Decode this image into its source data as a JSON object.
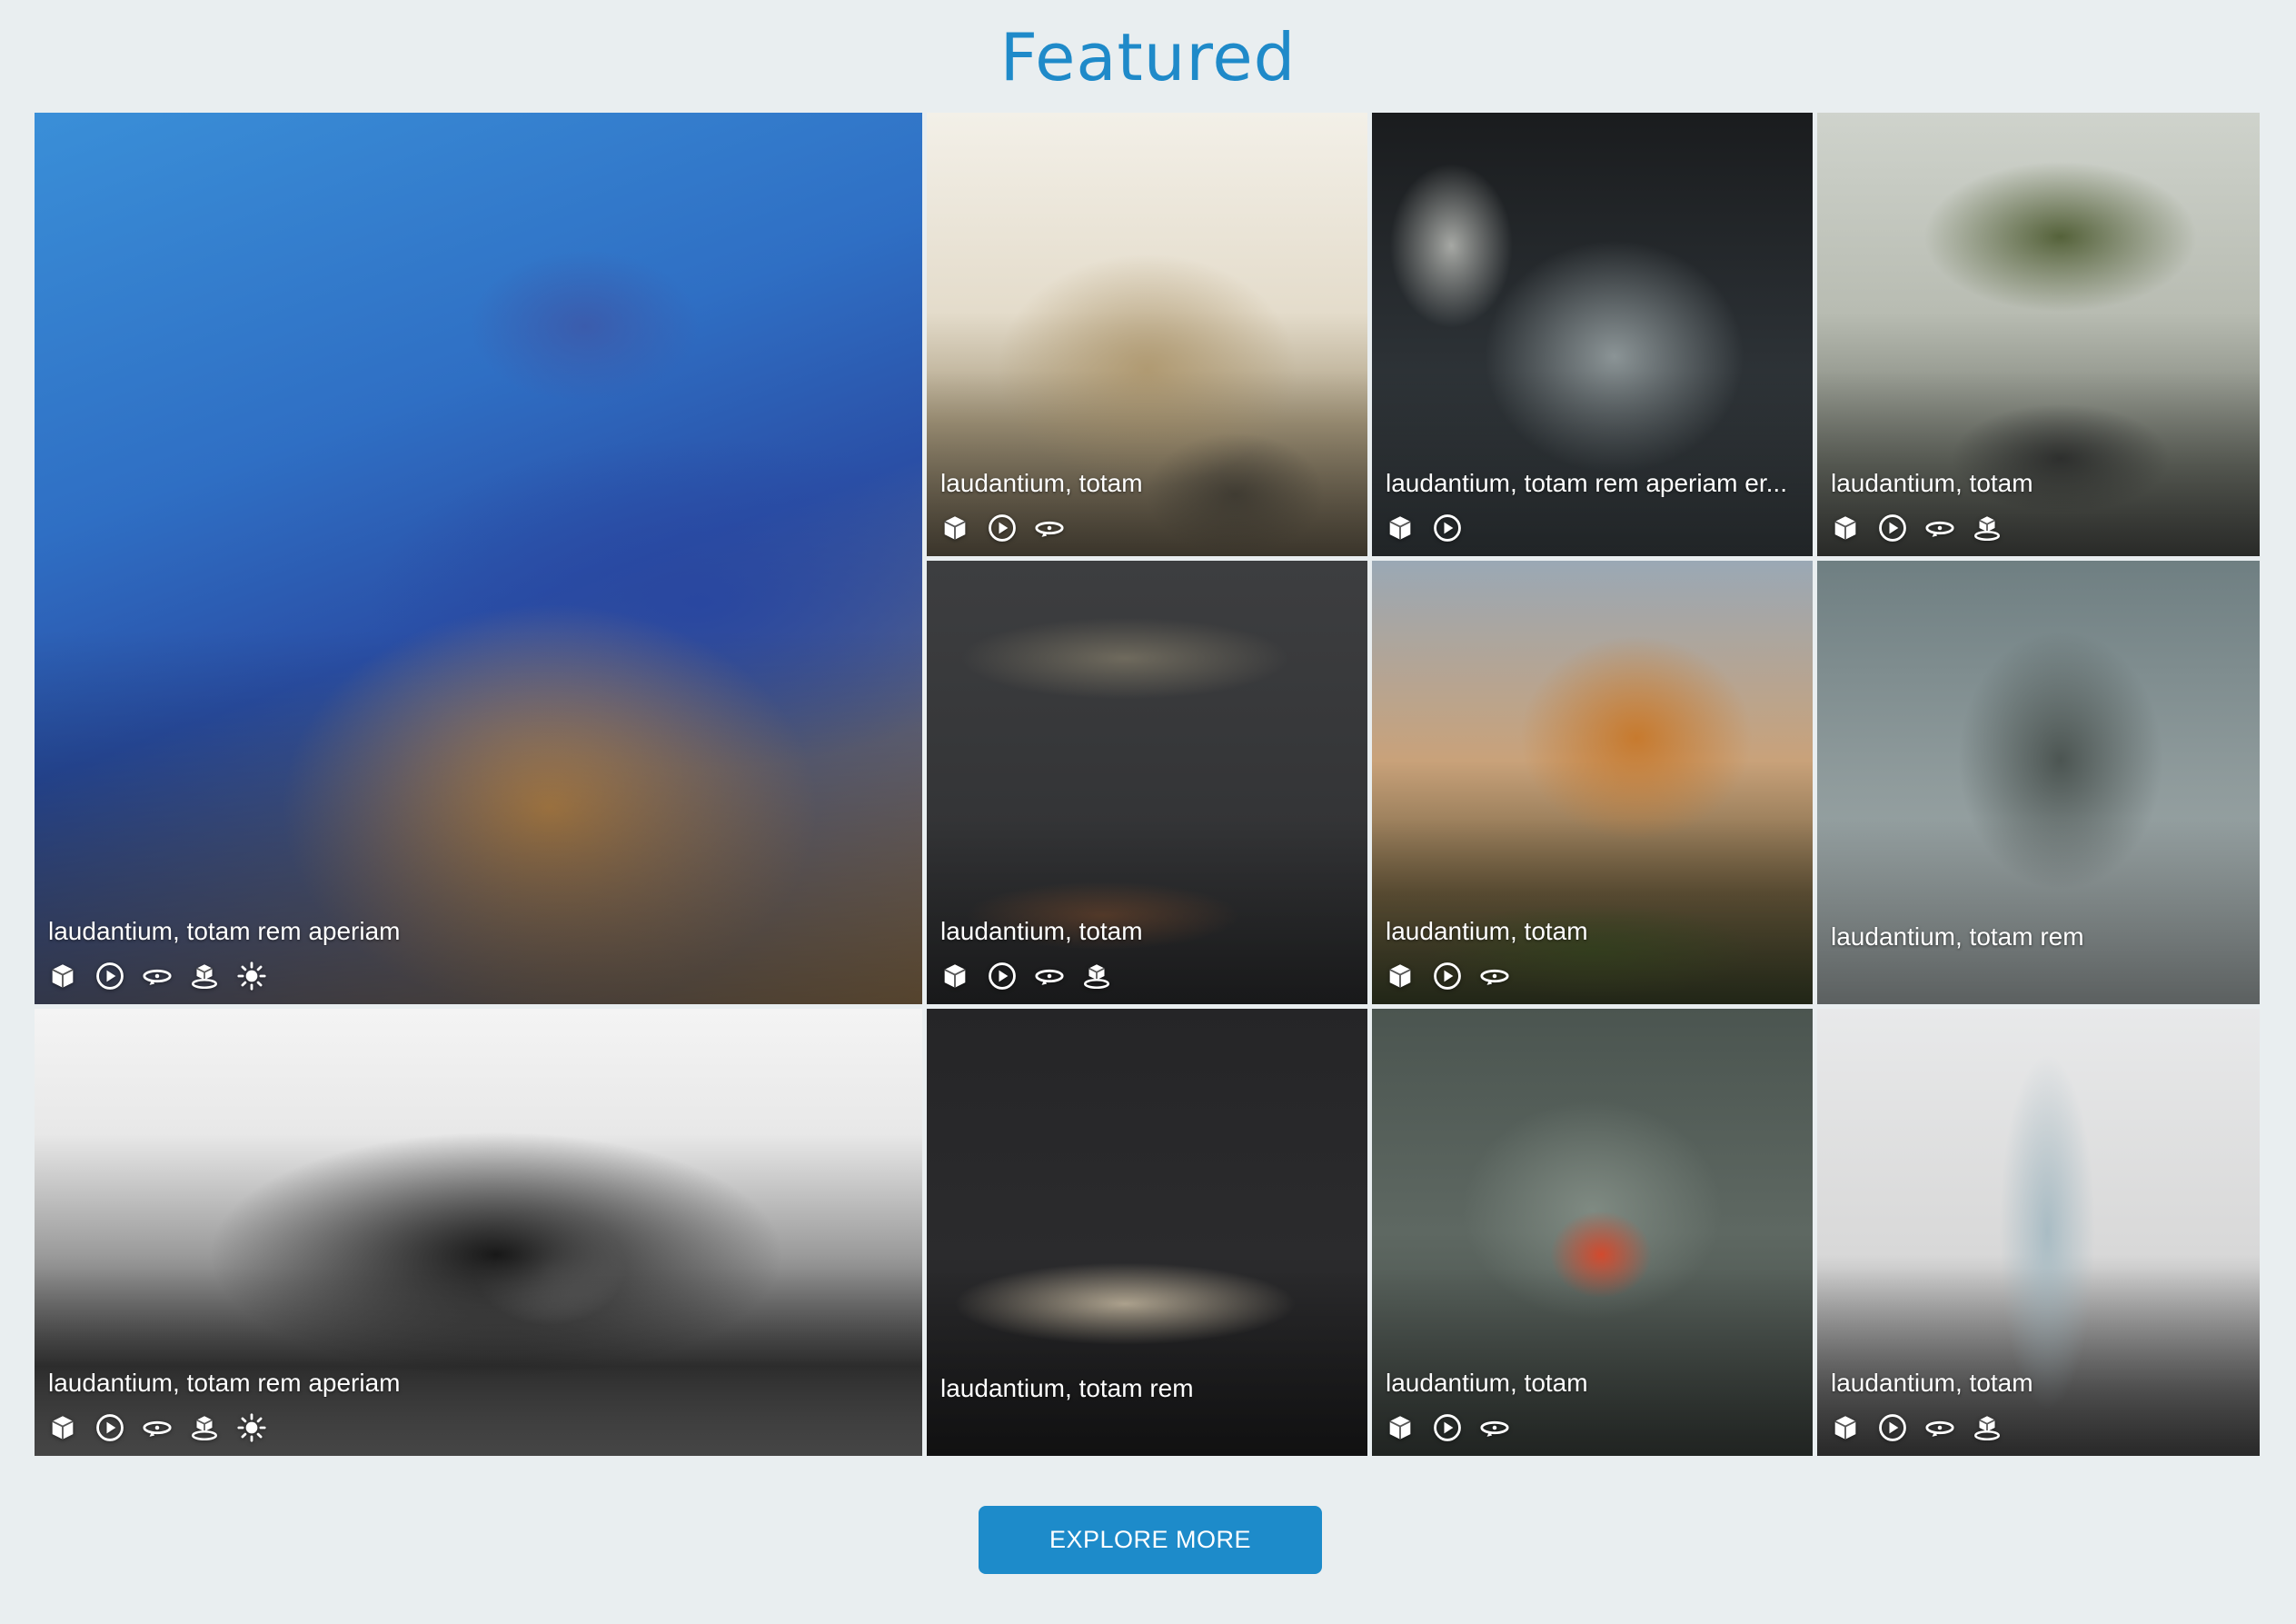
{
  "page": {
    "title": "Featured"
  },
  "icon_colors": {
    "icon": "#ffffff"
  },
  "tiles": [
    {
      "caption": "laudantium, totam rem aperiam",
      "icons": [
        "cube-icon",
        "play-icon",
        "orbit-icon",
        "gizmo-icon",
        "sun-icon"
      ]
    },
    {
      "caption": "laudantium, totam",
      "icons": [
        "cube-icon",
        "play-icon",
        "orbit-icon"
      ]
    },
    {
      "caption": "laudantium, totam rem aperiam er...",
      "icons": [
        "cube-icon",
        "play-icon"
      ]
    },
    {
      "caption": "laudantium, totam",
      "icons": [
        "cube-icon",
        "play-icon",
        "orbit-icon",
        "gizmo-icon"
      ]
    },
    {
      "caption": "laudantium, totam",
      "icons": [
        "cube-icon",
        "play-icon",
        "orbit-icon",
        "gizmo-icon"
      ]
    },
    {
      "caption": "laudantium, totam",
      "icons": [
        "cube-icon",
        "play-icon",
        "orbit-icon"
      ]
    },
    {
      "caption": "laudantium, totam rem",
      "icons": []
    },
    {
      "caption": "laudantium, totam rem aperiam",
      "icons": [
        "cube-icon",
        "play-icon",
        "orbit-icon",
        "gizmo-icon",
        "sun-icon"
      ]
    },
    {
      "caption": "laudantium, totam rem",
      "icons": []
    },
    {
      "caption": "laudantium, totam",
      "icons": [
        "cube-icon",
        "play-icon",
        "orbit-icon"
      ]
    },
    {
      "caption": "laudantium, totam",
      "icons": [
        "cube-icon",
        "play-icon",
        "orbit-icon",
        "gizmo-icon"
      ]
    }
  ],
  "explore_button": {
    "label": "EXPLORE MORE"
  }
}
